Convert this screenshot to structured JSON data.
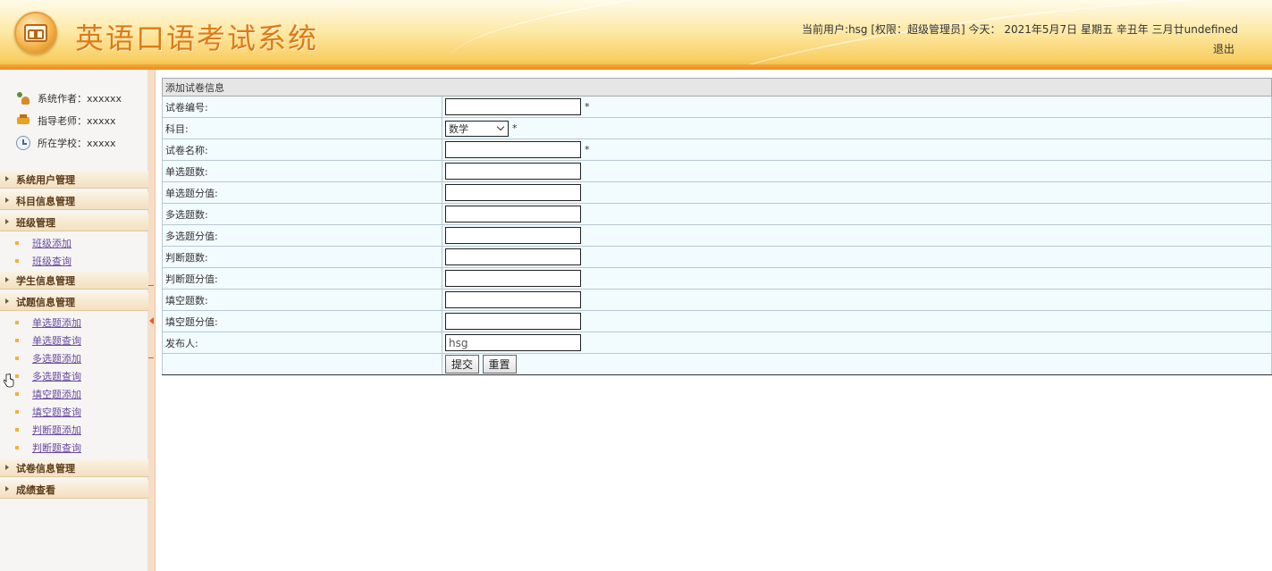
{
  "header": {
    "title": "英语口语考试系统",
    "user_info": "当前用户:hsg [权限：超级管理员] 今天：  2021年5月7日 星期五 辛丑年 三月廿undefined",
    "logout": "退出"
  },
  "sidebar": {
    "info": [
      {
        "label": "系统作者：xxxxxx",
        "icon": "people-icon"
      },
      {
        "label": "指导老师：xxxxx",
        "icon": "teacher-icon"
      },
      {
        "label": "所在学校：xxxxx",
        "icon": "clock-icon"
      }
    ],
    "menus": {
      "user_mgmt": "系统用户管理",
      "subject_mgmt": "科目信息管理",
      "class_mgmt": "班级管理",
      "class_add": "班级添加",
      "class_query": "班级查询",
      "student_mgmt": "学生信息管理",
      "question_mgmt": "试题信息管理",
      "single_add": "单选题添加",
      "single_query": "单选题查询",
      "multi_add": "多选题添加",
      "multi_query": "多选题查询",
      "fill_add": "填空题添加",
      "fill_query": "填空题查询",
      "judge_add": "判断题添加",
      "judge_query": "判断题查询",
      "paper_mgmt": "试卷信息管理",
      "score_view": "成绩查看"
    }
  },
  "form": {
    "caption": "添加试卷信息",
    "required_mark": "*",
    "fields": {
      "paper_no": {
        "label": "试卷编号:",
        "value": ""
      },
      "subject": {
        "label": "科目:",
        "value": "数学"
      },
      "paper_name": {
        "label": "试卷名称:",
        "value": ""
      },
      "single_count": {
        "label": "单选题数:",
        "value": ""
      },
      "single_score": {
        "label": "单选题分值:",
        "value": ""
      },
      "multi_count": {
        "label": "多选题数:",
        "value": ""
      },
      "multi_score": {
        "label": "多选题分值:",
        "value": ""
      },
      "judge_count": {
        "label": "判断题数:",
        "value": ""
      },
      "judge_score": {
        "label": "判断题分值:",
        "value": ""
      },
      "fill_count": {
        "label": "填空题数:",
        "value": ""
      },
      "fill_score": {
        "label": "填空题分值:",
        "value": ""
      },
      "publisher": {
        "label": "发布人:",
        "value": "hsg"
      }
    },
    "submit": "提交",
    "reset": "重置"
  }
}
